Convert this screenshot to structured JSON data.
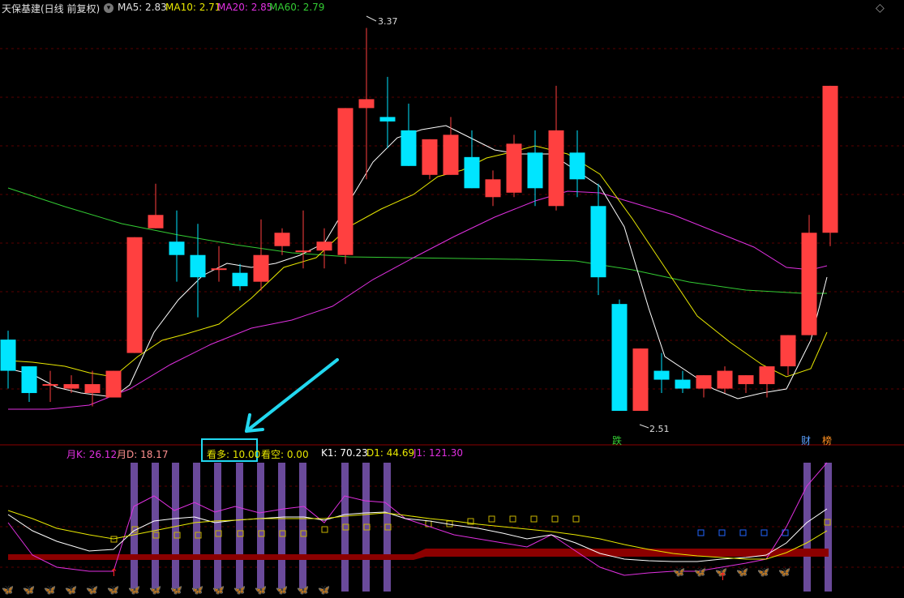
{
  "header": {
    "stock_name": "天保基建(日线 前复权)",
    "ma5": "MA5: 2.83",
    "ma10": "MA10: 2.71",
    "ma20": "MA20: 2.85",
    "ma60": "MA60: 2.79"
  },
  "price_labels": {
    "high": "3.37",
    "low": "2.51"
  },
  "tags": {
    "die": "跌",
    "cai": "财",
    "bang": "榜"
  },
  "indicator": {
    "yue_k": "月K: 26.12",
    "yue_d": "月D: 18.17",
    "kanduo": "看多: 10.00",
    "kankong": "看空: 0.00",
    "k1": "K1: 70.23",
    "d1": "D1: 44.69",
    "j1": "J1: 121.30"
  },
  "colors": {
    "up": "#ff4040",
    "down": "#00e5ff",
    "ma5": "#ffffff",
    "ma10": "#e8e800",
    "ma20": "#e030e0",
    "ma60": "#33cc33",
    "bg": "#000000",
    "axis": "#8b0000",
    "bar": "#6a4a9a",
    "baseline": "#8b0000"
  },
  "chart_data": {
    "type": "candlestick",
    "candles": [
      {
        "o": 2.67,
        "h": 2.69,
        "l": 2.56,
        "c": 2.6
      },
      {
        "o": 2.61,
        "h": 2.61,
        "l": 2.53,
        "c": 2.55
      },
      {
        "o": 2.57,
        "h": 2.6,
        "l": 2.53,
        "c": 2.57
      },
      {
        "o": 2.56,
        "h": 2.59,
        "l": 2.55,
        "c": 2.57
      },
      {
        "o": 2.55,
        "h": 2.6,
        "l": 2.52,
        "c": 2.57
      },
      {
        "o": 2.54,
        "h": 2.6,
        "l": 2.54,
        "c": 2.6
      },
      {
        "o": 2.64,
        "h": 2.9,
        "l": 2.64,
        "c": 2.9
      },
      {
        "o": 2.92,
        "h": 3.02,
        "l": 2.93,
        "c": 2.95
      },
      {
        "o": 2.89,
        "h": 2.96,
        "l": 2.8,
        "c": 2.86
      },
      {
        "o": 2.86,
        "h": 2.93,
        "l": 2.72,
        "c": 2.81
      },
      {
        "o": 2.83,
        "h": 2.88,
        "l": 2.8,
        "c": 2.83
      },
      {
        "o": 2.82,
        "h": 2.84,
        "l": 2.78,
        "c": 2.79
      },
      {
        "o": 2.8,
        "h": 2.94,
        "l": 2.78,
        "c": 2.86
      },
      {
        "o": 2.88,
        "h": 2.92,
        "l": 2.86,
        "c": 2.91
      },
      {
        "o": 2.87,
        "h": 2.96,
        "l": 2.83,
        "c": 2.87
      },
      {
        "o": 2.87,
        "h": 2.92,
        "l": 2.83,
        "c": 2.89
      },
      {
        "o": 2.86,
        "h": 3.07,
        "l": 2.84,
        "c": 3.19
      },
      {
        "o": 3.19,
        "h": 3.37,
        "l": 3.03,
        "c": 3.21
      },
      {
        "o": 3.17,
        "h": 3.26,
        "l": 3.1,
        "c": 3.16
      },
      {
        "o": 3.14,
        "h": 3.2,
        "l": 3.06,
        "c": 3.06
      },
      {
        "o": 3.04,
        "h": 3.12,
        "l": 3.03,
        "c": 3.12
      },
      {
        "o": 3.04,
        "h": 3.17,
        "l": 3.04,
        "c": 3.13
      },
      {
        "o": 3.08,
        "h": 3.14,
        "l": 3.01,
        "c": 3.01
      },
      {
        "o": 2.99,
        "h": 3.05,
        "l": 2.97,
        "c": 3.03
      },
      {
        "o": 3.0,
        "h": 3.13,
        "l": 2.99,
        "c": 3.11
      },
      {
        "o": 3.09,
        "h": 3.14,
        "l": 2.97,
        "c": 3.01
      },
      {
        "o": 2.97,
        "h": 3.24,
        "l": 2.96,
        "c": 3.14
      },
      {
        "o": 3.09,
        "h": 3.14,
        "l": 2.99,
        "c": 3.03
      },
      {
        "o": 2.97,
        "h": 3.02,
        "l": 2.77,
        "c": 2.81
      },
      {
        "o": 2.75,
        "h": 2.76,
        "l": 2.51,
        "c": 2.51
      },
      {
        "o": 2.51,
        "h": 2.65,
        "l": 2.51,
        "c": 2.65
      },
      {
        "o": 2.6,
        "h": 2.64,
        "l": 2.55,
        "c": 2.58
      },
      {
        "o": 2.58,
        "h": 2.6,
        "l": 2.55,
        "c": 2.56
      },
      {
        "o": 2.56,
        "h": 2.58,
        "l": 2.54,
        "c": 2.59
      },
      {
        "o": 2.56,
        "h": 2.61,
        "l": 2.55,
        "c": 2.6
      },
      {
        "o": 2.57,
        "h": 2.58,
        "l": 2.55,
        "c": 2.59
      },
      {
        "o": 2.57,
        "h": 2.61,
        "l": 2.54,
        "c": 2.61
      },
      {
        "o": 2.61,
        "h": 2.68,
        "l": 2.59,
        "c": 2.68
      },
      {
        "o": 2.68,
        "h": 2.95,
        "l": 2.7,
        "c": 2.91
      },
      {
        "o": 2.91,
        "h": 3.24,
        "l": 2.88,
        "c": 3.24
      }
    ]
  }
}
